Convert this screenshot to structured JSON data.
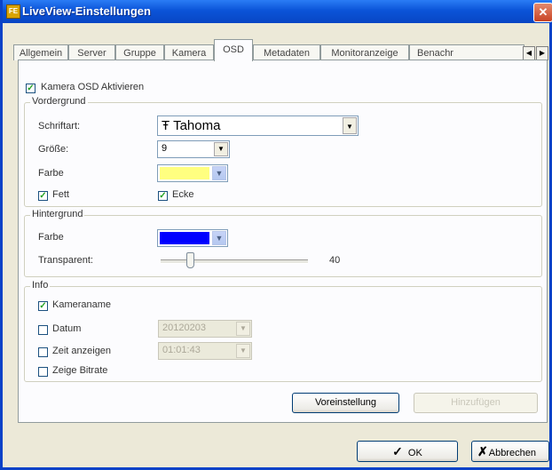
{
  "window": {
    "title": "LiveView-Einstellungen",
    "close_glyph": "✕",
    "app_icon_glyph": "FE"
  },
  "tabs": [
    {
      "label": "Allgemein",
      "active": false
    },
    {
      "label": "Server",
      "active": false
    },
    {
      "label": "Gruppe",
      "active": false
    },
    {
      "label": "Kamera",
      "active": false
    },
    {
      "label": "OSD",
      "active": true
    },
    {
      "label": "Metadaten",
      "active": false
    },
    {
      "label": "Monitoranzeige",
      "active": false
    },
    {
      "label": "Benachr",
      "active": false
    }
  ],
  "tab_scroll": {
    "left": "◀",
    "right": "▶"
  },
  "osd": {
    "enable_label": "Kamera OSD Aktivieren",
    "enable_checked": true,
    "foreground": {
      "title": "Vordergrund",
      "font_label": "Schriftart:",
      "font_value": "Tahoma",
      "font_icon": "Ŧ",
      "size_label": "Größe:",
      "size_value": "9",
      "color_label": "Farbe",
      "color_value": "#ffff80",
      "bold_label": "Fett",
      "bold_checked": true,
      "edge_label": "Ecke",
      "edge_checked": true
    },
    "background": {
      "title": "Hintergrund",
      "color_label": "Farbe",
      "color_value": "#0000ff",
      "transparent_label": "Transparent:",
      "transparent_value": "40",
      "transparent_max": 100
    },
    "info": {
      "title": "Info",
      "camera_name_label": "Kameraname",
      "camera_name_checked": true,
      "date_label": "Datum",
      "date_checked": false,
      "date_format": "20120203",
      "time_label": "Zeit anzeigen",
      "time_checked": false,
      "time_format": "01:01:43",
      "bitrate_label": "Zeige Bitrate",
      "bitrate_checked": false
    },
    "default_button": "Voreinstellung",
    "add_button": "Hinzufügen"
  },
  "footer": {
    "ok_label": "OK",
    "ok_glyph": "✓",
    "cancel_label": "Abbrechen",
    "cancel_glyph": "✗"
  },
  "check_glyph": "✓",
  "dropdown_glyph": "▼"
}
